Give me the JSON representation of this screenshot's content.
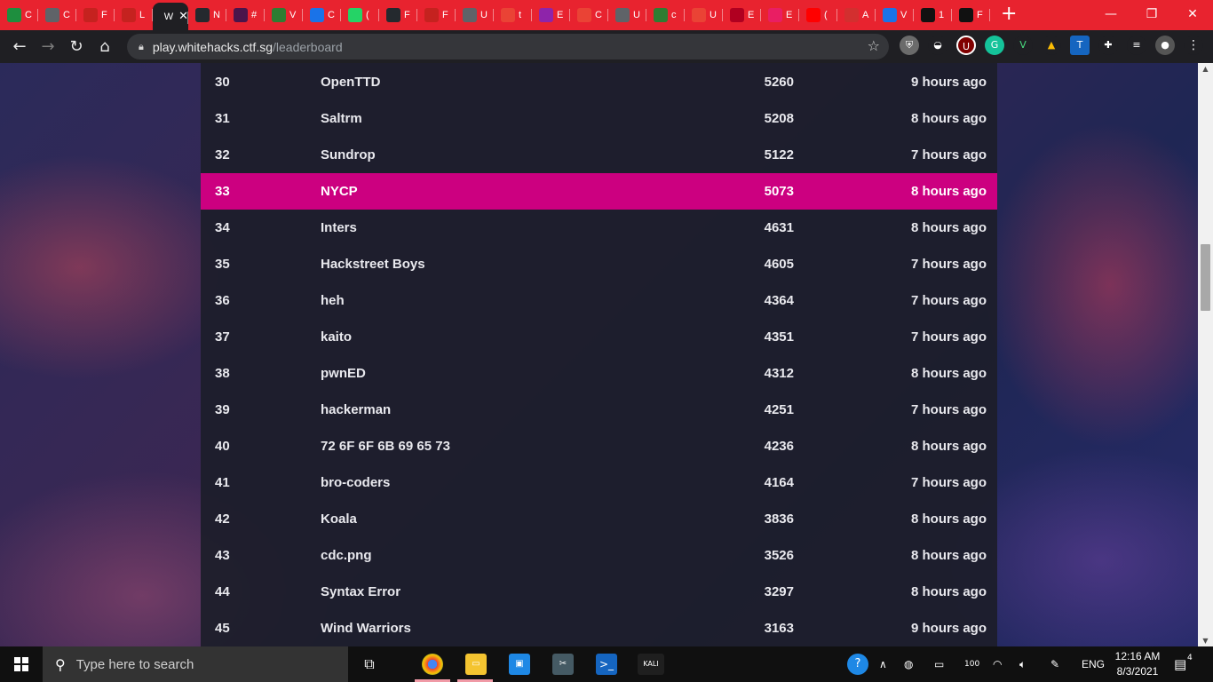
{
  "browser": {
    "url_host": "play.whitehacks.ctf.sg",
    "url_path": "/leaderboard",
    "active_tab_label": "W",
    "tabs": [
      {
        "label": "C",
        "color": "#1e8e3e"
      },
      {
        "label": "C",
        "color": "#5f6368"
      },
      {
        "label": "F",
        "color": "#c5221f"
      },
      {
        "label": "L",
        "color": "#c5221f"
      },
      {
        "label": "W",
        "color": "#1f1f23"
      },
      {
        "label": "N",
        "color": "#24292e"
      },
      {
        "label": "#",
        "color": "#4a154b"
      },
      {
        "label": "V",
        "color": "#2e7d32"
      },
      {
        "label": "C",
        "color": "#1a73e8"
      },
      {
        "label": "(",
        "color": "#25d366"
      },
      {
        "label": "F",
        "color": "#24292e"
      },
      {
        "label": "F",
        "color": "#c5221f"
      },
      {
        "label": "U",
        "color": "#5f6368"
      },
      {
        "label": "t",
        "color": "#ea4335"
      },
      {
        "label": "E",
        "color": "#8e24aa"
      },
      {
        "label": "C",
        "color": "#ea4335"
      },
      {
        "label": "U",
        "color": "#5f6368"
      },
      {
        "label": "c",
        "color": "#2e7d32"
      },
      {
        "label": "U",
        "color": "#ea4335"
      },
      {
        "label": "E",
        "color": "#b00020"
      },
      {
        "label": "E",
        "color": "#e91e63"
      },
      {
        "label": "(",
        "color": "#ff0000"
      },
      {
        "label": "A",
        "color": "#d32f2f"
      },
      {
        "label": "V",
        "color": "#1a73e8"
      },
      {
        "label": "1",
        "color": "#111111"
      },
      {
        "label": "F",
        "color": "#111111"
      }
    ],
    "new_tab_label": "+",
    "window_controls": {
      "minimize": "—",
      "restore": "❐",
      "close": "✕"
    }
  },
  "leaderboard": {
    "rows": [
      {
        "rank": "30",
        "team": "OpenTTD",
        "score": "5260",
        "time": "9 hours ago",
        "highlight": false
      },
      {
        "rank": "31",
        "team": "Saltrm",
        "score": "5208",
        "time": "8 hours ago",
        "highlight": false
      },
      {
        "rank": "32",
        "team": "Sundrop",
        "score": "5122",
        "time": "7 hours ago",
        "highlight": false
      },
      {
        "rank": "33",
        "team": "NYCP",
        "score": "5073",
        "time": "8 hours ago",
        "highlight": true
      },
      {
        "rank": "34",
        "team": "Inters",
        "score": "4631",
        "time": "8 hours ago",
        "highlight": false
      },
      {
        "rank": "35",
        "team": "Hackstreet Boys",
        "score": "4605",
        "time": "7 hours ago",
        "highlight": false
      },
      {
        "rank": "36",
        "team": "heh",
        "score": "4364",
        "time": "7 hours ago",
        "highlight": false
      },
      {
        "rank": "37",
        "team": "kaito",
        "score": "4351",
        "time": "7 hours ago",
        "highlight": false
      },
      {
        "rank": "38",
        "team": "pwnED",
        "score": "4312",
        "time": "8 hours ago",
        "highlight": false
      },
      {
        "rank": "39",
        "team": "hackerman",
        "score": "4251",
        "time": "7 hours ago",
        "highlight": false
      },
      {
        "rank": "40",
        "team": "72 6F 6F 6B 69 65 73",
        "score": "4236",
        "time": "8 hours ago",
        "highlight": false
      },
      {
        "rank": "41",
        "team": "bro-coders",
        "score": "4164",
        "time": "7 hours ago",
        "highlight": false
      },
      {
        "rank": "42",
        "team": "Koala",
        "score": "3836",
        "time": "8 hours ago",
        "highlight": false
      },
      {
        "rank": "43",
        "team": "cdc.png",
        "score": "3526",
        "time": "8 hours ago",
        "highlight": false
      },
      {
        "rank": "44",
        "team": "Syntax Error",
        "score": "3297",
        "time": "8 hours ago",
        "highlight": false
      },
      {
        "rank": "45",
        "team": "Wind Warriors",
        "score": "3163",
        "time": "9 hours ago",
        "highlight": false
      }
    ],
    "highlight_color": "#cc0080"
  },
  "taskbar": {
    "search_placeholder": "Type here to search",
    "kali_label": "KALI",
    "language": "ENG",
    "time": "12:16 AM",
    "date": "8/3/2021",
    "notification_count": "4"
  }
}
